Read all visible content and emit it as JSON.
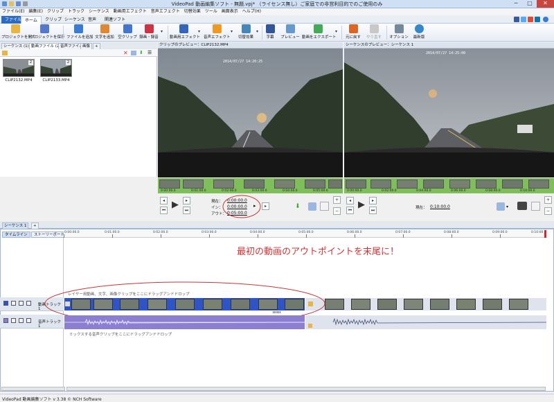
{
  "window": {
    "title": "VideoPad 動画編集ソフト - 無題.vpj* （ライセンス無し）ご家庭での非営利目的でのご使用のみ",
    "minimize": "─",
    "maximize": "□",
    "close": "✕"
  },
  "menubar": [
    "ファイル(E)",
    "編集(E)",
    "クリップ",
    "トラック",
    "シーケンス",
    "動画用エフェクト",
    "音声エフェクト",
    "切替効果",
    "ツール",
    "画面表示",
    "ヘルプ(H)"
  ],
  "ribbon_tabs": [
    "ファイル",
    "ホーム",
    "クリップ",
    "シーケンス",
    "音声",
    "関連ソフト"
  ],
  "ribbon_buttons": [
    {
      "label": "プロジェクトを開く",
      "icon": "folder-open-icon",
      "color": "#e8b540"
    },
    {
      "label": "プロジェクトを保存",
      "icon": "save-icon",
      "color": "#5577cc"
    },
    {
      "label": "ファイルを追加",
      "icon": "add-file-icon",
      "color": "#3a7bd5"
    },
    {
      "label": "文字を追加",
      "icon": "text-icon",
      "color": "#dd8833"
    },
    {
      "label": "空クリップ",
      "icon": "blank-clip-icon",
      "color": "#4477cc"
    },
    {
      "label": "録画・録音",
      "icon": "record-icon",
      "color": "#cc3344"
    },
    {
      "label": "動画用エフェクト",
      "icon": "video-effect-icon",
      "color": "#3366bb"
    },
    {
      "label": "音声エフェクト",
      "icon": "audio-effect-icon",
      "color": "#ee9922"
    },
    {
      "label": "切替効果",
      "icon": "transition-icon",
      "color": "#4488bb"
    },
    {
      "label": "字幕",
      "icon": "subtitle-icon",
      "color": "#335599"
    },
    {
      "label": "プレビュー",
      "icon": "preview-icon",
      "color": "#6699cc"
    },
    {
      "label": "動画をエクスポート",
      "icon": "export-icon",
      "color": "#44aa55"
    },
    {
      "label": "元に戻す",
      "icon": "undo-icon",
      "color": "#dd6622"
    },
    {
      "label": "やり直す",
      "icon": "redo-icon",
      "color": "#aaaaaa"
    },
    {
      "label": "オプション",
      "icon": "options-icon",
      "color": "#778899"
    },
    {
      "label": "最新版",
      "icon": "update-icon",
      "color": "#3388cc"
    }
  ],
  "bin_tabs": [
    "シーケンス (1)",
    "動画ファイル (2)",
    "音声ファイル",
    "画像",
    "+"
  ],
  "clips": [
    {
      "name": "CLIP2132.MP4",
      "badge": "2"
    },
    {
      "name": "CLIP2133.MP4",
      "badge": "2"
    }
  ],
  "clip_preview": {
    "header": "クリップのプレビュー：CLIP2132.MP4",
    "osd": "2014/07/27  14:20:25",
    "current_label": "現在：",
    "current_value": "0:00:00.0",
    "in_label": "イン：",
    "in_value": "0:00:00.0",
    "out_label": "アウト：",
    "out_value": "0:05:00.0",
    "strip_times": [
      "0:00:00.0",
      "0:01:00.0",
      "0:02:00.0",
      "0:03:00.0",
      "0:04:00.0",
      "0:05:00.0"
    ]
  },
  "seq_preview": {
    "header": "シーケンスのプレビュー：シーケンス 1",
    "osd": "2014/07/27  14:25:00",
    "current_label": "現在：",
    "current_value": "0:10:00.0",
    "strip_times": [
      "0:00:00.0",
      "0:02:00.0",
      "0:04:00.0",
      "0:06:00.0",
      "0:08:00.0",
      "0:10:00.0"
    ]
  },
  "sequence_tabs": [
    "シーケンス 1",
    "+"
  ],
  "timeline": {
    "tab_timeline": "タイムライン",
    "tab_storyboard": "ストーリーボード",
    "ruler": [
      "0:00:00.0",
      "0:01:00.0",
      "0:02:00.0",
      "0:03:00.0",
      "0:04:00.0",
      "0:05:00.0",
      "0:06:00.0",
      "0:07:00.0",
      "0:08:00.0",
      "0:09:00.0",
      "0:10:00"
    ],
    "overlay_hint": "レイヤー用動画、文字、画像クリップをここにドラッグアンドドロップ",
    "video_track": "動画トラック 1",
    "audio_track": "音声トラック 1",
    "audio_hint": "ミックスする音声クリップをここにドラッグアンドドロップ",
    "annotation": "最初の動画のアウトポイントを末尾に！"
  },
  "status": "VideoPad 動画編集ソフト v 3.38 © NCH Software",
  "colors": {
    "annotation": "#cc3333",
    "clip_strip": "#7fbf5a",
    "video_clip_selected": "#2f54c9",
    "audio_clip_selected": "#8c7ed0",
    "audio_clip": "#dfe3ee"
  }
}
